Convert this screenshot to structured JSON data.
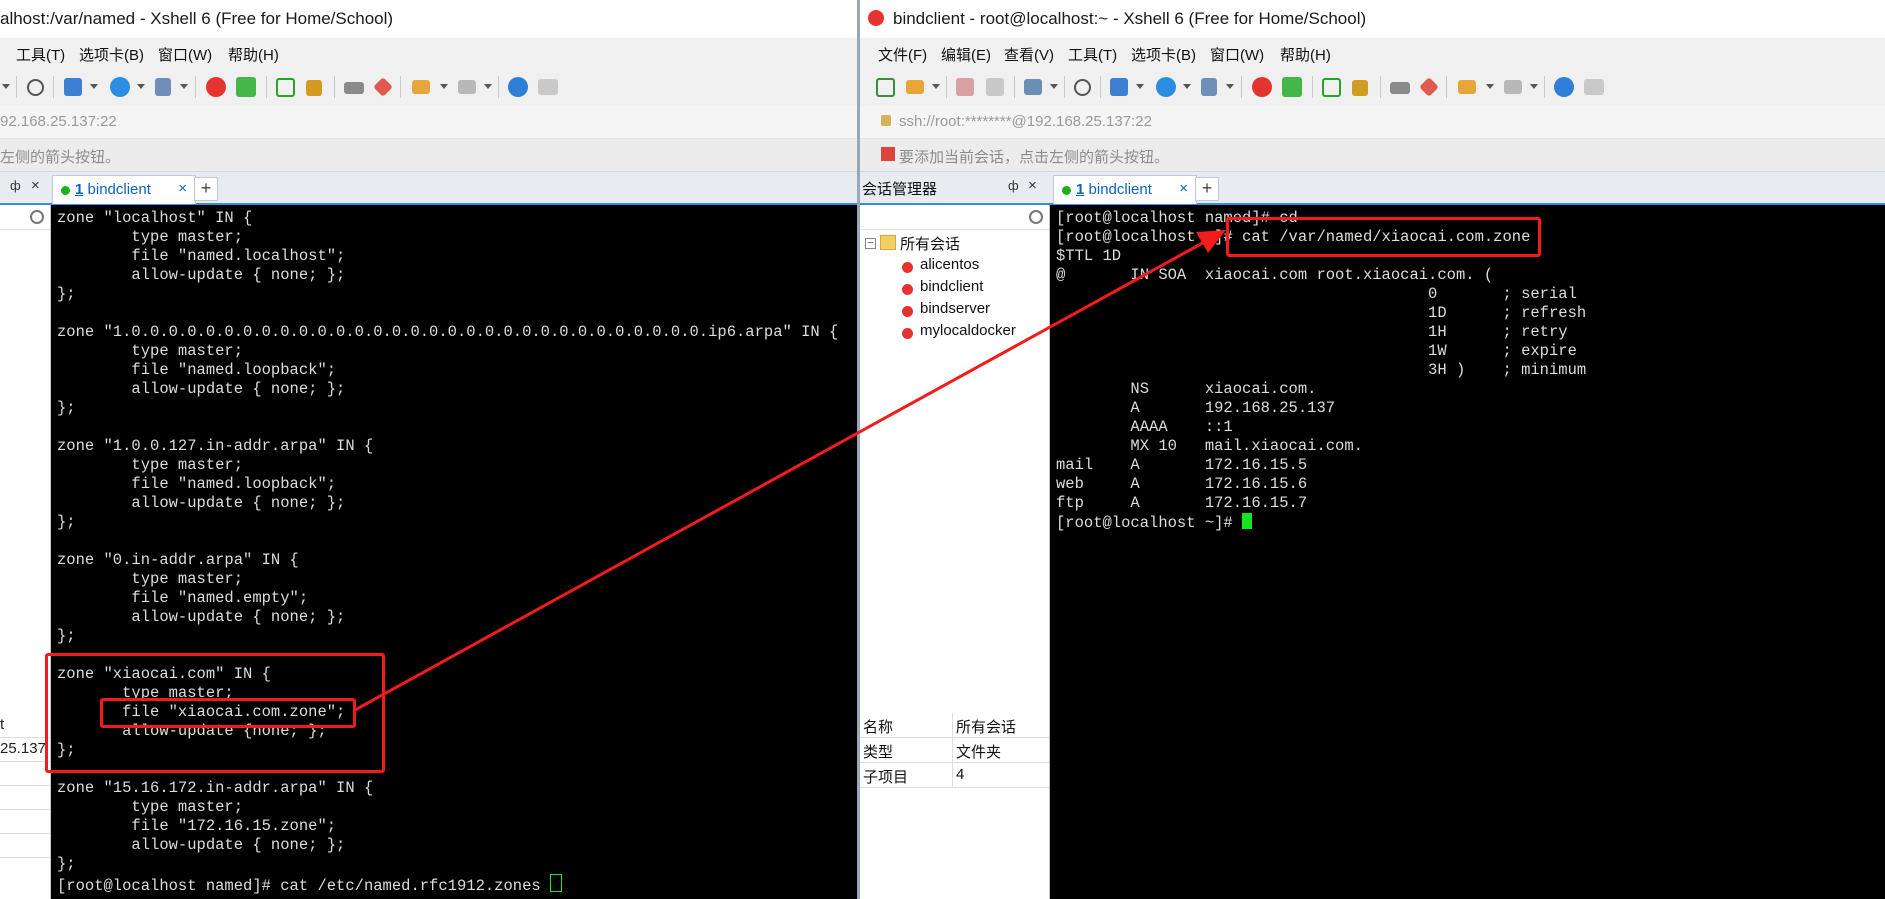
{
  "left_window": {
    "title": "alhost:/var/named - Xshell 6 (Free for Home/School)",
    "menu": [
      "工具(T)",
      "选项卡(B)",
      "窗口(W)",
      "帮助(H)"
    ],
    "address": "92.168.25.137:22",
    "hint": "左侧的箭头按钮。",
    "pane_header": "",
    "tab": {
      "number": "1",
      "label": "bindclient",
      "close": "×"
    },
    "tab_add": "+",
    "pane_values": [
      "t",
      "25.137"
    ],
    "terminal_lines": [
      "zone \"localhost\" IN {",
      "        type master;",
      "        file \"named.localhost\";",
      "        allow-update { none; };",
      "};",
      "",
      "zone \"1.0.0.0.0.0.0.0.0.0.0.0.0.0.0.0.0.0.0.0.0.0.0.0.0.0.0.0.0.0.0.0.ip6.arpa\" IN {",
      "        type master;",
      "        file \"named.loopback\";",
      "        allow-update { none; };",
      "};",
      "",
      "zone \"1.0.0.127.in-addr.arpa\" IN {",
      "        type master;",
      "        file \"named.loopback\";",
      "        allow-update { none; };",
      "};",
      "",
      "zone \"0.in-addr.arpa\" IN {",
      "        type master;",
      "        file \"named.empty\";",
      "        allow-update { none; };",
      "};",
      "",
      "zone \"xiaocai.com\" IN {",
      "       type master;",
      "       file \"xiaocai.com.zone\";",
      "       allow-update {none; };",
      "};",
      "",
      "zone \"15.16.172.in-addr.arpa\" IN {",
      "        type master;",
      "        file \"172.16.15.zone\";",
      "        allow-update { none; };",
      "};"
    ],
    "prompt": "[root@localhost named]# cat /etc/named.rfc1912.zones "
  },
  "right_window": {
    "title": "bindclient - root@localhost:~ - Xshell 6 (Free for Home/School)",
    "menu": [
      "文件(F)",
      "编辑(E)",
      "查看(V)",
      "工具(T)",
      "选项卡(B)",
      "窗口(W)",
      "帮助(H)"
    ],
    "address": "ssh://root:********@192.168.25.137:22",
    "hint": "要添加当前会话，点击左侧的箭头按钮。",
    "session_manager": {
      "title": "会话管理器",
      "pin": "ф",
      "close": "×",
      "root": "所有会话",
      "sessions": [
        "alicentos",
        "bindclient",
        "bindserver",
        "mylocaldocker"
      ],
      "properties": [
        {
          "key": "名称",
          "value": "所有会话"
        },
        {
          "key": "类型",
          "value": "文件夹"
        },
        {
          "key": "子项目",
          "value": "4"
        }
      ]
    },
    "tab": {
      "number": "1",
      "label": "bindclient",
      "close": "×"
    },
    "tab_add": "+",
    "terminal_lines": [
      "[root@localhost named]# cd",
      "[root@localhost ~]# cat /var/named/xiaocai.com.zone",
      "$TTL 1D",
      "@       IN SOA  xiaocai.com root.xiaocai.com. (",
      "                                        0       ; serial",
      "                                        1D      ; refresh",
      "                                        1H      ; retry",
      "                                        1W      ; expire",
      "                                        3H )    ; minimum",
      "        NS      xiaocai.com.",
      "        A       192.168.25.137",
      "        AAAA    ::1",
      "        MX 10   mail.xiaocai.com.",
      "mail    A       172.16.15.5",
      "web     A       172.16.15.6",
      "ftp     A       172.16.15.7"
    ],
    "prompt": "[root@localhost ~]# "
  },
  "colors": {
    "annotation_red": "#f21c1c",
    "terminal_bg": "#000000",
    "terminal_fg": "#dcdcdc",
    "cursor": "#19e619",
    "tab_blue": "#0b63c4"
  }
}
